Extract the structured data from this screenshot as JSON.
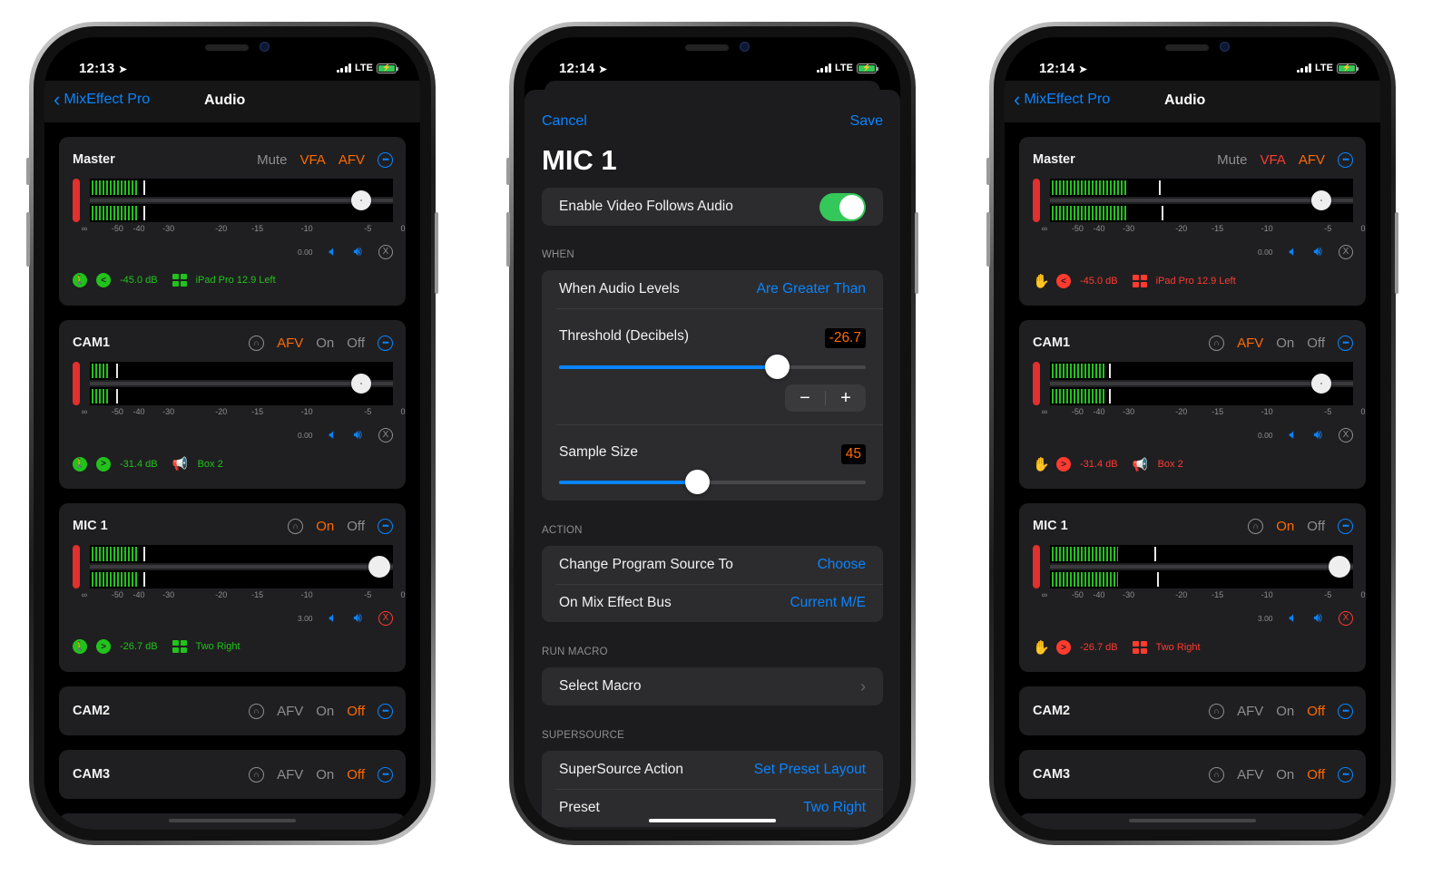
{
  "colors": {
    "accent_blue": "#0a84ff",
    "orange": "#ff6a00",
    "red": "#ff3b30",
    "green": "#22c21c",
    "switch_green": "#34c759"
  },
  "phones": [
    {
      "status": {
        "time": "12:13",
        "carrier": "LTE"
      },
      "nav": {
        "back_label": "MixEffect Pro",
        "title": "Audio"
      },
      "status_color": "green",
      "channels": [
        {
          "name": "Master",
          "toggles": [
            {
              "label": "Mute",
              "state": "off"
            },
            {
              "label": "VFA",
              "state": "orange"
            },
            {
              "label": "AFV",
              "state": "orange"
            }
          ],
          "headphones": false,
          "meter_level_db": [
            -45,
            -45
          ],
          "peak_db": [
            -42,
            -42
          ],
          "fader_db": -4.5,
          "gain": "0.00",
          "x_active": false,
          "status": {
            "mode": "walk",
            "cmp": "<",
            "level": "-45.0 dB",
            "target_icon": "grid",
            "target": "iPad Pro 12.9 Left"
          }
        },
        {
          "name": "CAM1",
          "toggles": [
            {
              "label": "AFV",
              "state": "orange"
            },
            {
              "label": "On",
              "state": "off"
            },
            {
              "label": "Off",
              "state": "off"
            }
          ],
          "headphones": true,
          "meter_level_db": [
            -55,
            -55
          ],
          "peak_db": [
            -53,
            -53
          ],
          "fader_db": -4.5,
          "gain": "0.00",
          "x_active": false,
          "status": {
            "mode": "walk",
            "cmp": ">",
            "level": "-31.4 dB",
            "target_icon": "megaphone",
            "target": "Box 2"
          }
        },
        {
          "name": "MIC 1",
          "toggles": [
            {
              "label": "On",
              "state": "orange"
            },
            {
              "label": "Off",
              "state": "off"
            }
          ],
          "headphones": true,
          "meter_level_db": [
            -45,
            -45
          ],
          "peak_db": [
            -42,
            -42
          ],
          "fader_db": -2,
          "big_knob": true,
          "gain": "3.00",
          "x_active": true,
          "status": {
            "mode": "walk",
            "cmp": ">",
            "level": "-26.7 dB",
            "target_icon": "grid",
            "target": "Two Right"
          }
        }
      ],
      "mini_channels": [
        {
          "name": "CAM2",
          "toggles": [
            {
              "label": "AFV",
              "state": "off"
            },
            {
              "label": "On",
              "state": "off"
            },
            {
              "label": "Off",
              "state": "orange"
            }
          ]
        },
        {
          "name": "CAM3",
          "toggles": [
            {
              "label": "AFV",
              "state": "off"
            },
            {
              "label": "On",
              "state": "off"
            },
            {
              "label": "Off",
              "state": "orange"
            }
          ]
        }
      ]
    },
    {
      "status": {
        "time": "12:14",
        "carrier": "LTE"
      },
      "nav": {
        "back_label": "MixEffect Pro",
        "title": "Audio"
      },
      "status_color": "red",
      "channels": [
        {
          "name": "Master",
          "toggles": [
            {
              "label": "Mute",
              "state": "off"
            },
            {
              "label": "VFA",
              "state": "red"
            },
            {
              "label": "AFV",
              "state": "orange"
            }
          ],
          "headphones": false,
          "meter_level_db": [
            -33,
            -33
          ],
          "peak_db": [
            -25,
            -24.5
          ],
          "fader_db": -4.5,
          "gain": "0.00",
          "x_active": false,
          "status": {
            "mode": "hand",
            "cmp": "<",
            "level": "-45.0 dB",
            "target_icon": "grid",
            "target": "iPad Pro 12.9 Left"
          }
        },
        {
          "name": "CAM1",
          "toggles": [
            {
              "label": "AFV",
              "state": "orange"
            },
            {
              "label": "On",
              "state": "off"
            },
            {
              "label": "Off",
              "state": "off"
            }
          ],
          "headphones": true,
          "meter_level_db": [
            -41,
            -41
          ],
          "peak_db": [
            -39.5,
            -39.5
          ],
          "fader_db": -4.5,
          "gain": "0.00",
          "x_active": false,
          "status": {
            "mode": "hand",
            "cmp": ">",
            "level": "-31.4 dB",
            "target_icon": "megaphone",
            "target": "Box 2"
          }
        },
        {
          "name": "MIC 1",
          "toggles": [
            {
              "label": "On",
              "state": "orange"
            },
            {
              "label": "Off",
              "state": "off"
            }
          ],
          "headphones": true,
          "meter_level_db": [
            -36,
            -36
          ],
          "peak_db": [
            -26,
            -25.5
          ],
          "fader_db": -2,
          "big_knob": true,
          "gain": "3.00",
          "x_active": true,
          "status": {
            "mode": "hand",
            "cmp": ">",
            "level": "-26.7 dB",
            "target_icon": "grid",
            "target": "Two Right"
          }
        }
      ],
      "mini_channels": [
        {
          "name": "CAM2",
          "toggles": [
            {
              "label": "AFV",
              "state": "off"
            },
            {
              "label": "On",
              "state": "off"
            },
            {
              "label": "Off",
              "state": "orange"
            }
          ]
        },
        {
          "name": "CAM3",
          "toggles": [
            {
              "label": "AFV",
              "state": "off"
            },
            {
              "label": "On",
              "state": "off"
            },
            {
              "label": "Off",
              "state": "orange"
            }
          ]
        }
      ]
    }
  ],
  "meter_scale": [
    "∞",
    "-50",
    "-40",
    "-30",
    "-20",
    "-15",
    "-10",
    "-5",
    "0"
  ],
  "editor": {
    "status": {
      "time": "12:14",
      "carrier": "LTE"
    },
    "cancel": "Cancel",
    "save": "Save",
    "title": "MIC 1",
    "enable_vfa": {
      "label": "Enable Video Follows Audio",
      "on": true
    },
    "when": {
      "section": "WHEN",
      "levels_label": "When Audio Levels",
      "levels_value": "Are Greater Than",
      "threshold_label": "Threshold (Decibels)",
      "threshold_value": "-26.7",
      "threshold_fraction": 0.71,
      "stepper_minus": "−",
      "stepper_plus": "+",
      "sample_label": "Sample Size",
      "sample_value": "45",
      "sample_fraction": 0.45
    },
    "action": {
      "section": "ACTION",
      "source_label": "Change Program Source To",
      "source_value": "Choose",
      "bus_label": "On Mix Effect Bus",
      "bus_value": "Current M/E"
    },
    "macro": {
      "section": "RUN MACRO",
      "label": "Select Macro"
    },
    "supersource": {
      "section": "SUPERSOURCE",
      "action_label": "SuperSource Action",
      "action_value": "Set Preset Layout",
      "preset_label": "Preset",
      "preset_value": "Two Right"
    }
  }
}
